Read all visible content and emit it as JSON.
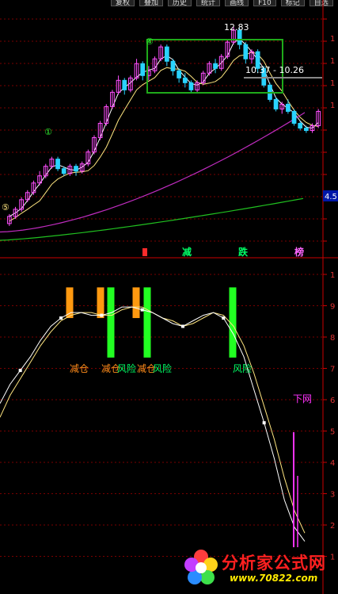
{
  "toolbar": {
    "items": [
      "复权",
      "叠加",
      "历史",
      "统计",
      "画线",
      "F10",
      "标记",
      "自选"
    ]
  },
  "chart_data": [
    {
      "type": "candlestick",
      "panel": "upper",
      "colors": {
        "up": "#ff4fff",
        "down": "#29d3ff",
        "ma_short": "#ffffff",
        "ma_mid": "#ffe680",
        "ma_long": "#c02cc0",
        "ma_longest": "#20c020",
        "box": "#1faa1a"
      },
      "y_tick_labels": [
        "1",
        "1",
        "1",
        "1"
      ],
      "price_box_label": "4.5",
      "annotations": {
        "high_label": "12.83",
        "range_label": "10.37 - 10.26",
        "markers": [
          "①",
          "④",
          "⑤"
        ],
        "signals": [
          {
            "text": "减",
            "color": "#00ff66"
          },
          {
            "text": "跌",
            "color": "#00ff66"
          },
          {
            "text": "榜",
            "color": "#ff66ff"
          }
        ]
      },
      "candles": [
        {
          "o": 4.6,
          "c": 4.9,
          "h": 5.0,
          "l": 4.5
        },
        {
          "o": 4.9,
          "c": 5.2,
          "h": 5.3,
          "l": 4.8
        },
        {
          "o": 5.2,
          "c": 5.6,
          "h": 5.7,
          "l": 5.1
        },
        {
          "o": 5.6,
          "c": 5.9,
          "h": 6.0,
          "l": 5.5
        },
        {
          "o": 5.9,
          "c": 6.3,
          "h": 6.4,
          "l": 5.8
        },
        {
          "o": 6.3,
          "c": 6.6,
          "h": 6.8,
          "l": 6.2
        },
        {
          "o": 6.6,
          "c": 7.0,
          "h": 7.1,
          "l": 6.5
        },
        {
          "o": 7.0,
          "c": 7.3,
          "h": 7.4,
          "l": 6.9
        },
        {
          "o": 7.3,
          "c": 6.9,
          "h": 7.4,
          "l": 6.8
        },
        {
          "o": 6.9,
          "c": 6.7,
          "h": 7.0,
          "l": 6.6
        },
        {
          "o": 6.7,
          "c": 7.0,
          "h": 7.1,
          "l": 6.6
        },
        {
          "o": 7.0,
          "c": 6.8,
          "h": 7.1,
          "l": 6.6
        },
        {
          "o": 6.8,
          "c": 7.1,
          "h": 7.2,
          "l": 6.7
        },
        {
          "o": 7.1,
          "c": 7.6,
          "h": 7.7,
          "l": 7.0
        },
        {
          "o": 7.6,
          "c": 8.2,
          "h": 8.3,
          "l": 7.5
        },
        {
          "o": 8.2,
          "c": 8.8,
          "h": 8.9,
          "l": 8.1
        },
        {
          "o": 8.8,
          "c": 9.5,
          "h": 9.6,
          "l": 8.7
        },
        {
          "o": 9.5,
          "c": 10.1,
          "h": 10.2,
          "l": 9.4
        },
        {
          "o": 10.1,
          "c": 10.6,
          "h": 10.8,
          "l": 10.0
        },
        {
          "o": 10.6,
          "c": 10.2,
          "h": 10.7,
          "l": 10.0
        },
        {
          "o": 10.2,
          "c": 10.7,
          "h": 10.8,
          "l": 10.1
        },
        {
          "o": 10.7,
          "c": 11.3,
          "h": 11.5,
          "l": 10.6
        },
        {
          "o": 11.3,
          "c": 10.8,
          "h": 11.4,
          "l": 10.6
        },
        {
          "o": 10.8,
          "c": 11.0,
          "h": 11.2,
          "l": 10.6
        },
        {
          "o": 11.0,
          "c": 11.5,
          "h": 11.6,
          "l": 10.9
        },
        {
          "o": 11.5,
          "c": 12.0,
          "h": 12.1,
          "l": 11.4
        },
        {
          "o": 12.0,
          "c": 11.4,
          "h": 12.1,
          "l": 11.2
        },
        {
          "o": 11.4,
          "c": 11.0,
          "h": 11.5,
          "l": 10.8
        },
        {
          "o": 11.0,
          "c": 10.7,
          "h": 11.1,
          "l": 10.5
        },
        {
          "o": 10.7,
          "c": 10.5,
          "h": 10.9,
          "l": 10.3
        },
        {
          "o": 10.5,
          "c": 10.2,
          "h": 10.6,
          "l": 10.1
        },
        {
          "o": 10.2,
          "c": 10.5,
          "h": 10.6,
          "l": 10.1
        },
        {
          "o": 10.5,
          "c": 10.9,
          "h": 11.0,
          "l": 10.4
        },
        {
          "o": 10.9,
          "c": 11.3,
          "h": 11.4,
          "l": 10.8
        },
        {
          "o": 11.3,
          "c": 11.1,
          "h": 11.5,
          "l": 10.9
        },
        {
          "o": 11.1,
          "c": 11.6,
          "h": 11.7,
          "l": 11.0
        },
        {
          "o": 11.6,
          "c": 12.2,
          "h": 12.3,
          "l": 11.5
        },
        {
          "o": 12.2,
          "c": 12.7,
          "h": 12.83,
          "l": 12.1
        },
        {
          "o": 12.7,
          "c": 12.1,
          "h": 12.8,
          "l": 11.9
        },
        {
          "o": 12.1,
          "c": 11.5,
          "h": 12.2,
          "l": 11.3
        },
        {
          "o": 11.5,
          "c": 11.8,
          "h": 11.9,
          "l": 11.3
        },
        {
          "o": 11.8,
          "c": 11.1,
          "h": 11.9,
          "l": 10.9
        },
        {
          "o": 11.1,
          "c": 10.4,
          "h": 11.2,
          "l": 10.3
        },
        {
          "o": 10.4,
          "c": 9.8,
          "h": 10.5,
          "l": 9.7
        },
        {
          "o": 9.8,
          "c": 9.4,
          "h": 9.9,
          "l": 9.3
        },
        {
          "o": 9.4,
          "c": 9.6,
          "h": 9.7,
          "l": 9.2
        },
        {
          "o": 9.6,
          "c": 9.3,
          "h": 9.8,
          "l": 9.2
        },
        {
          "o": 9.3,
          "c": 8.8,
          "h": 9.4,
          "l": 8.7
        },
        {
          "o": 8.8,
          "c": 8.6,
          "h": 8.9,
          "l": 8.5
        },
        {
          "o": 8.6,
          "c": 8.5,
          "h": 8.7,
          "l": 8.4
        },
        {
          "o": 8.5,
          "c": 8.7,
          "h": 8.8,
          "l": 8.4
        },
        {
          "o": 8.7,
          "c": 9.3,
          "h": 9.4,
          "l": 8.6
        }
      ],
      "ylim": [
        4.0,
        13.5
      ]
    },
    {
      "type": "indicator",
      "panel": "lower",
      "y_tick_labels": [
        "1",
        "9",
        "8",
        "7",
        "6",
        "5",
        "4",
        "3",
        "2",
        "1"
      ],
      "labels": [
        {
          "text": "减仓",
          "color": "#ff8c1a"
        },
        {
          "text": "减仓",
          "color": "#ff8c1a"
        },
        {
          "text": "风险",
          "color": "#00ff66"
        },
        {
          "text": "减仓",
          "color": "#ff8c1a"
        },
        {
          "text": "风险",
          "color": "#00ff66"
        },
        {
          "text": "风险",
          "color": "#00ff66"
        },
        {
          "text": "下网",
          "color": "#ff33ff"
        }
      ],
      "bars": [
        {
          "kind": "orange",
          "top": 1.0,
          "bottom": 0.86
        },
        {
          "kind": "orange",
          "top": 1.0,
          "bottom": 0.86
        },
        {
          "kind": "green",
          "top": 1.0,
          "bottom": 0.78
        },
        {
          "kind": "orange",
          "top": 1.0,
          "bottom": 0.86
        },
        {
          "kind": "green",
          "top": 1.0,
          "bottom": 0.78
        },
        {
          "kind": "green",
          "top": 1.0,
          "bottom": 0.78
        }
      ],
      "line_white": [
        0.55,
        0.62,
        0.67,
        0.72,
        0.78,
        0.83,
        0.86,
        0.88,
        0.88,
        0.87,
        0.87,
        0.88,
        0.9,
        0.9,
        0.89,
        0.88,
        0.86,
        0.84,
        0.83,
        0.85,
        0.87,
        0.88,
        0.86,
        0.8,
        0.72,
        0.6,
        0.48,
        0.35,
        0.2,
        0.1,
        0.05
      ],
      "line_yellow": [
        0.5,
        0.58,
        0.64,
        0.7,
        0.76,
        0.81,
        0.85,
        0.87,
        0.88,
        0.88,
        0.87,
        0.87,
        0.89,
        0.9,
        0.9,
        0.88,
        0.86,
        0.85,
        0.83,
        0.84,
        0.86,
        0.88,
        0.87,
        0.83,
        0.76,
        0.66,
        0.54,
        0.42,
        0.28,
        0.16,
        0.08
      ],
      "spike": {
        "label": "下网",
        "color": "#ff33ff"
      },
      "ylim": [
        0,
        1.05
      ]
    }
  ],
  "watermark": {
    "brand": "分析家公式网",
    "url": "www.70822.com"
  }
}
